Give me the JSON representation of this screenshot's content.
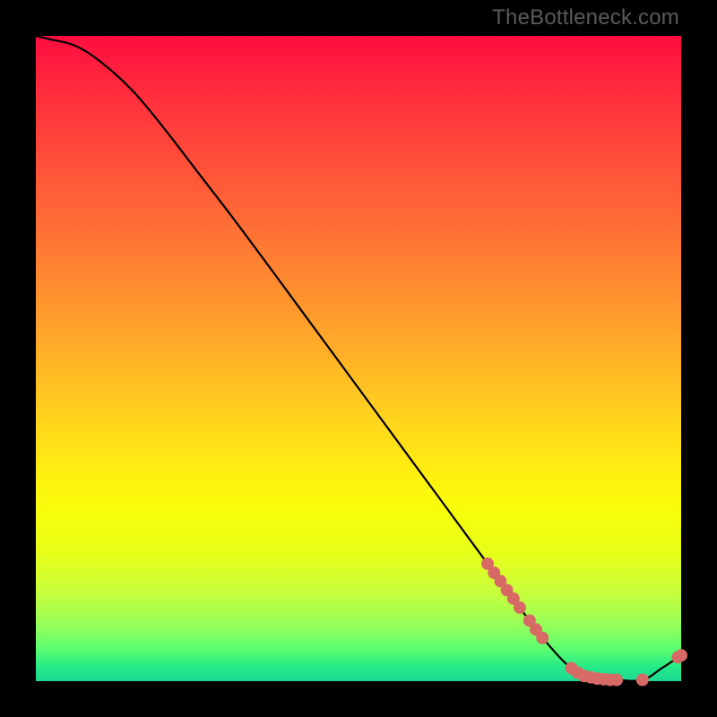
{
  "watermark": "TheBottleneck.com",
  "colors": {
    "marker": "#d76a64",
    "line": "#000000"
  },
  "chart_data": {
    "type": "line",
    "title": "",
    "xlabel": "",
    "ylabel": "",
    "xlim": [
      0,
      100
    ],
    "ylim": [
      0,
      100
    ],
    "grid": false,
    "series": [
      {
        "name": "bottleneck-curve",
        "x": [
          0,
          2,
          6,
          10,
          15,
          20,
          25,
          30,
          35,
          40,
          45,
          50,
          55,
          60,
          65,
          70,
          73,
          75,
          77,
          80,
          83,
          86,
          90,
          94,
          97,
          100
        ],
        "y": [
          100,
          99.5,
          98.5,
          96.0,
          91.5,
          85.5,
          79.0,
          72.5,
          65.8,
          59.0,
          52.2,
          45.4,
          38.6,
          31.8,
          25.0,
          18.2,
          14.1,
          11.4,
          8.7,
          5.0,
          2.0,
          0.6,
          0.2,
          0.2,
          2.0,
          4.0
        ]
      }
    ],
    "markers": [
      {
        "x": 70.0,
        "y": 18.2
      },
      {
        "x": 71.0,
        "y": 16.8
      },
      {
        "x": 72.0,
        "y": 15.5
      },
      {
        "x": 73.0,
        "y": 14.1
      },
      {
        "x": 74.0,
        "y": 12.8
      },
      {
        "x": 75.0,
        "y": 11.4
      },
      {
        "x": 76.5,
        "y": 9.4
      },
      {
        "x": 77.5,
        "y": 8.0
      },
      {
        "x": 78.5,
        "y": 6.7
      },
      {
        "x": 83.0,
        "y": 2.0
      },
      {
        "x": 84.0,
        "y": 1.3
      },
      {
        "x": 85.0,
        "y": 0.8
      },
      {
        "x": 86.0,
        "y": 0.6
      },
      {
        "x": 87.0,
        "y": 0.4
      },
      {
        "x": 88.0,
        "y": 0.3
      },
      {
        "x": 89.0,
        "y": 0.2
      },
      {
        "x": 90.0,
        "y": 0.2
      },
      {
        "x": 94.0,
        "y": 0.2
      },
      {
        "x": 99.5,
        "y": 3.7
      },
      {
        "x": 100.0,
        "y": 4.0
      }
    ]
  }
}
